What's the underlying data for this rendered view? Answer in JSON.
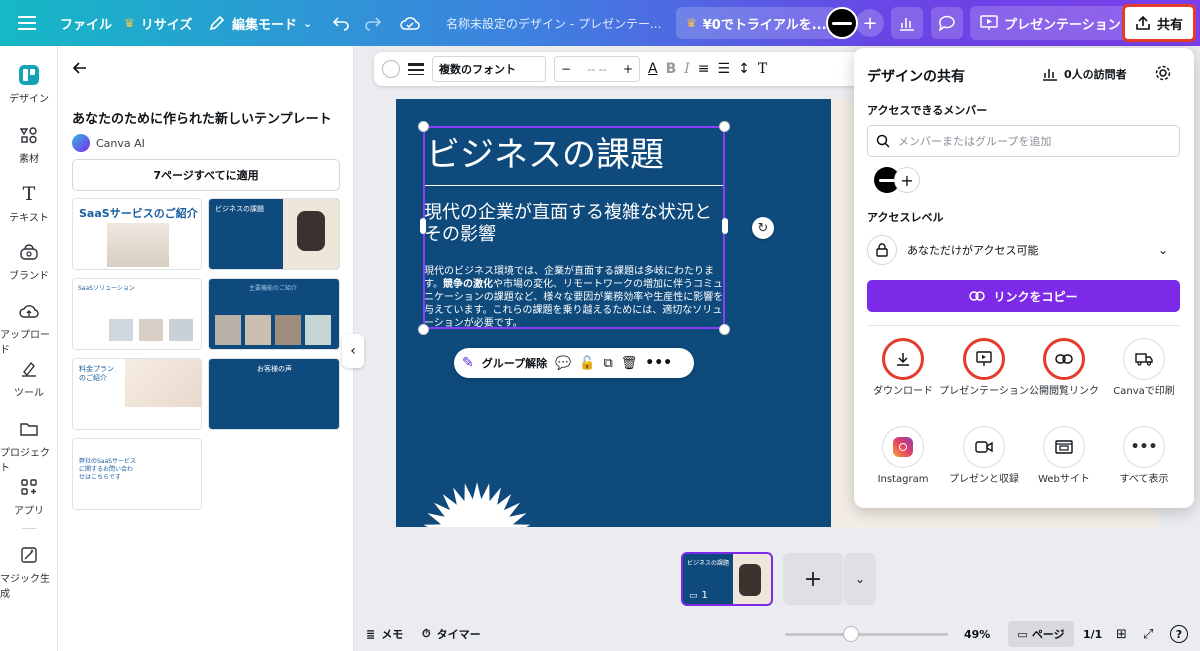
{
  "topbar": {
    "file": "ファイル",
    "resize": "リサイズ",
    "edit_mode": "編集モード",
    "doc_title": "名称未設定のデザイン - プレゼンテー...",
    "trial": "¥0でトライアルを...",
    "present": "プレゼンテーション",
    "share": "共有"
  },
  "rail": {
    "items": [
      "デザイン",
      "素材",
      "テキスト",
      "ブランド",
      "アップロード",
      "ツール",
      "プロジェクト",
      "アプリ",
      "マジック生成"
    ]
  },
  "panel": {
    "heading": "あなたのために作られた新しいテンプレート",
    "source": "Canva AI",
    "apply_all": "7ページすべてに適用",
    "thumbs": {
      "t1_title": "SaaSサービスのご紹介",
      "t2_title": "ビジネスの課題",
      "t3_title": "SaaSソリューション",
      "t4_title": "主要機能のご紹介",
      "t5_title": "料金プラン\nのご紹介",
      "t6_title": "お客様の声",
      "t7_title": "弊社のSaaSサービス\nに関するお問い合わ\nせはこちらです"
    }
  },
  "format_toolbar": {
    "font": "複数のフォント",
    "size": "-- --"
  },
  "slide": {
    "title": "ビジネスの課題",
    "subtitle": "現代の企業が直面する複雑な状況とその影響",
    "body_pre": "現代のビジネス環境では、企業が直面する課題は多岐にわたります。",
    "body_bold": "競争の激化",
    "body_post": "や市場の変化、リモートワークの増加に伴うコミュニケーションの課題など、様々な要因が業務効率や生産性に影響を与えています。これらの課題を乗り越えるためには、適切なソリューションが必要です。"
  },
  "context_menu": {
    "ungroup": "グループ解除"
  },
  "share": {
    "title": "デザインの共有",
    "visitors": "0人の訪問者",
    "members_label": "アクセスできるメンバー",
    "search_placeholder": "メンバーまたはグループを追加",
    "access_level_label": "アクセスレベル",
    "access_value": "あなただけがアクセス可能",
    "copy_link": "リンクをコピー",
    "options": [
      "ダウンロード",
      "プレゼンテーション",
      "公開閲覧リンク",
      "Canvaで印刷",
      "Instagram",
      "プレゼンと収録",
      "Webサイト",
      "すべて表示"
    ]
  },
  "pages": {
    "thumb_label": "1"
  },
  "bottom": {
    "notes": "メモ",
    "timer": "タイマー",
    "zoom": "49%",
    "page_label": "ページ",
    "page_count": "1/1"
  },
  "colors": {
    "accent": "#7d2ae8",
    "slide_bg": "#0e4a7c",
    "highlight": "#e53b2c"
  }
}
